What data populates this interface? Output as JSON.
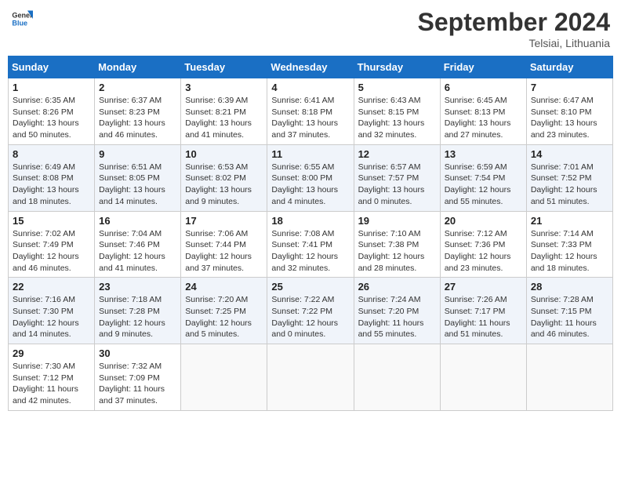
{
  "header": {
    "logo_line1": "General",
    "logo_line2": "Blue",
    "month_title": "September 2024",
    "location": "Telsiai, Lithuania"
  },
  "weekdays": [
    "Sunday",
    "Monday",
    "Tuesday",
    "Wednesday",
    "Thursday",
    "Friday",
    "Saturday"
  ],
  "weeks": [
    [
      {
        "day": "1",
        "info": "Sunrise: 6:35 AM\nSunset: 8:26 PM\nDaylight: 13 hours\nand 50 minutes."
      },
      {
        "day": "2",
        "info": "Sunrise: 6:37 AM\nSunset: 8:23 PM\nDaylight: 13 hours\nand 46 minutes."
      },
      {
        "day": "3",
        "info": "Sunrise: 6:39 AM\nSunset: 8:21 PM\nDaylight: 13 hours\nand 41 minutes."
      },
      {
        "day": "4",
        "info": "Sunrise: 6:41 AM\nSunset: 8:18 PM\nDaylight: 13 hours\nand 37 minutes."
      },
      {
        "day": "5",
        "info": "Sunrise: 6:43 AM\nSunset: 8:15 PM\nDaylight: 13 hours\nand 32 minutes."
      },
      {
        "day": "6",
        "info": "Sunrise: 6:45 AM\nSunset: 8:13 PM\nDaylight: 13 hours\nand 27 minutes."
      },
      {
        "day": "7",
        "info": "Sunrise: 6:47 AM\nSunset: 8:10 PM\nDaylight: 13 hours\nand 23 minutes."
      }
    ],
    [
      {
        "day": "8",
        "info": "Sunrise: 6:49 AM\nSunset: 8:08 PM\nDaylight: 13 hours\nand 18 minutes."
      },
      {
        "day": "9",
        "info": "Sunrise: 6:51 AM\nSunset: 8:05 PM\nDaylight: 13 hours\nand 14 minutes."
      },
      {
        "day": "10",
        "info": "Sunrise: 6:53 AM\nSunset: 8:02 PM\nDaylight: 13 hours\nand 9 minutes."
      },
      {
        "day": "11",
        "info": "Sunrise: 6:55 AM\nSunset: 8:00 PM\nDaylight: 13 hours\nand 4 minutes."
      },
      {
        "day": "12",
        "info": "Sunrise: 6:57 AM\nSunset: 7:57 PM\nDaylight: 13 hours\nand 0 minutes."
      },
      {
        "day": "13",
        "info": "Sunrise: 6:59 AM\nSunset: 7:54 PM\nDaylight: 12 hours\nand 55 minutes."
      },
      {
        "day": "14",
        "info": "Sunrise: 7:01 AM\nSunset: 7:52 PM\nDaylight: 12 hours\nand 51 minutes."
      }
    ],
    [
      {
        "day": "15",
        "info": "Sunrise: 7:02 AM\nSunset: 7:49 PM\nDaylight: 12 hours\nand 46 minutes."
      },
      {
        "day": "16",
        "info": "Sunrise: 7:04 AM\nSunset: 7:46 PM\nDaylight: 12 hours\nand 41 minutes."
      },
      {
        "day": "17",
        "info": "Sunrise: 7:06 AM\nSunset: 7:44 PM\nDaylight: 12 hours\nand 37 minutes."
      },
      {
        "day": "18",
        "info": "Sunrise: 7:08 AM\nSunset: 7:41 PM\nDaylight: 12 hours\nand 32 minutes."
      },
      {
        "day": "19",
        "info": "Sunrise: 7:10 AM\nSunset: 7:38 PM\nDaylight: 12 hours\nand 28 minutes."
      },
      {
        "day": "20",
        "info": "Sunrise: 7:12 AM\nSunset: 7:36 PM\nDaylight: 12 hours\nand 23 minutes."
      },
      {
        "day": "21",
        "info": "Sunrise: 7:14 AM\nSunset: 7:33 PM\nDaylight: 12 hours\nand 18 minutes."
      }
    ],
    [
      {
        "day": "22",
        "info": "Sunrise: 7:16 AM\nSunset: 7:30 PM\nDaylight: 12 hours\nand 14 minutes."
      },
      {
        "day": "23",
        "info": "Sunrise: 7:18 AM\nSunset: 7:28 PM\nDaylight: 12 hours\nand 9 minutes."
      },
      {
        "day": "24",
        "info": "Sunrise: 7:20 AM\nSunset: 7:25 PM\nDaylight: 12 hours\nand 5 minutes."
      },
      {
        "day": "25",
        "info": "Sunrise: 7:22 AM\nSunset: 7:22 PM\nDaylight: 12 hours\nand 0 minutes."
      },
      {
        "day": "26",
        "info": "Sunrise: 7:24 AM\nSunset: 7:20 PM\nDaylight: 11 hours\nand 55 minutes."
      },
      {
        "day": "27",
        "info": "Sunrise: 7:26 AM\nSunset: 7:17 PM\nDaylight: 11 hours\nand 51 minutes."
      },
      {
        "day": "28",
        "info": "Sunrise: 7:28 AM\nSunset: 7:15 PM\nDaylight: 11 hours\nand 46 minutes."
      }
    ],
    [
      {
        "day": "29",
        "info": "Sunrise: 7:30 AM\nSunset: 7:12 PM\nDaylight: 11 hours\nand 42 minutes."
      },
      {
        "day": "30",
        "info": "Sunrise: 7:32 AM\nSunset: 7:09 PM\nDaylight: 11 hours\nand 37 minutes."
      },
      {
        "day": "",
        "info": ""
      },
      {
        "day": "",
        "info": ""
      },
      {
        "day": "",
        "info": ""
      },
      {
        "day": "",
        "info": ""
      },
      {
        "day": "",
        "info": ""
      }
    ]
  ]
}
